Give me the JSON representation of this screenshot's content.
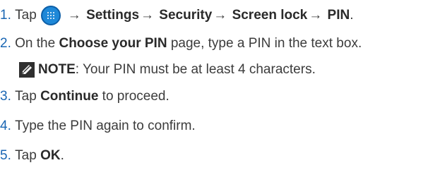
{
  "steps": [
    {
      "num": "1.",
      "tap": "Tap",
      "arrow1": "→",
      "settings": "Settings",
      "arrow2": "→",
      "security": "Security",
      "arrow3": "→",
      "screen_lock": "Screen lock",
      "arrow4": "→",
      "pin": "PIN",
      "end": "."
    },
    {
      "num": "2.",
      "pre": "On the",
      "bold": "Choose your PIN",
      "post": "page, type a PIN in the text box."
    },
    {
      "note_label": "NOTE",
      "note_text": ": Your PIN must be at least 4 characters."
    },
    {
      "num": "3.",
      "pre": "Tap",
      "bold": "Continue",
      "post": "to proceed."
    },
    {
      "num": "4.",
      "text": "Type the PIN again to confirm."
    },
    {
      "num": "5.",
      "pre": "Tap",
      "bold": "OK",
      "post": "."
    }
  ],
  "icons": {
    "apps": "apps-icon",
    "note": "note-pencil-icon"
  },
  "colors": {
    "number": "#1a66b3",
    "apps_icon": "#1e88d8",
    "text": "#3c3c3c"
  }
}
